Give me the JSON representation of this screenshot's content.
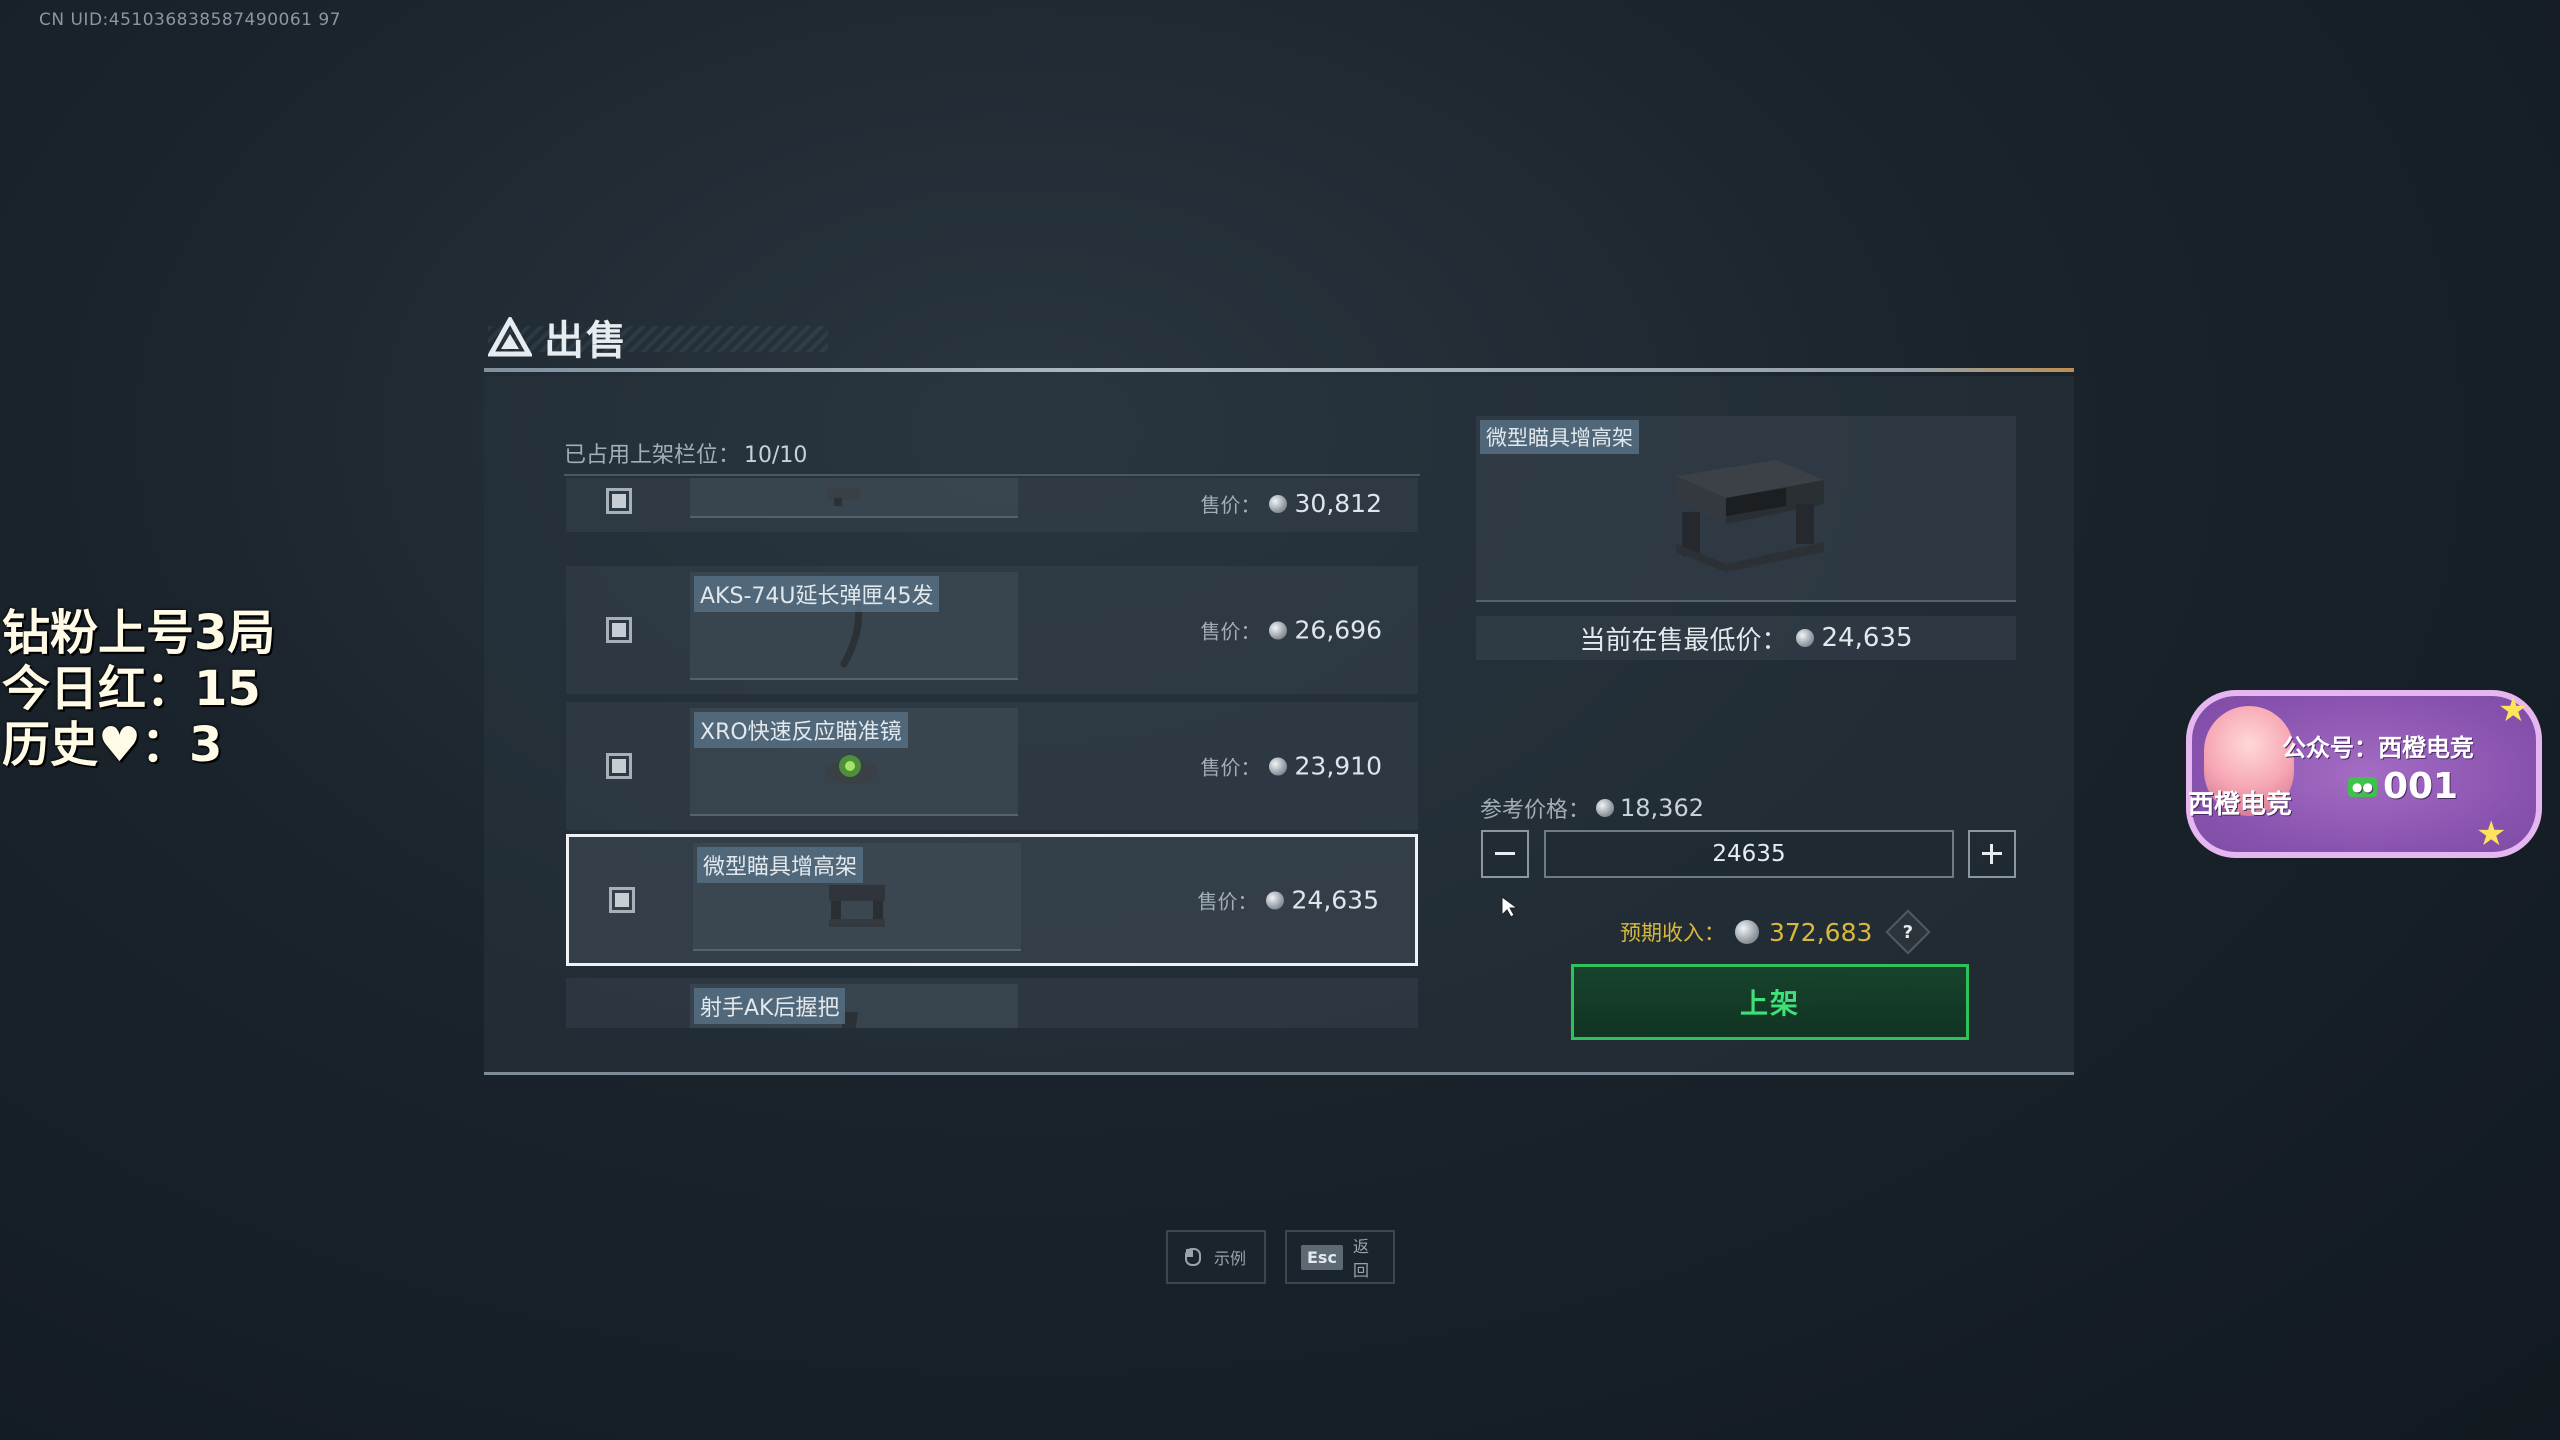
{
  "uid": "CN UID:451036838587490061 97",
  "overlay": {
    "line1": "钻粉上号3局",
    "line2": "今日红：15",
    "line3": "历史♥：3"
  },
  "header": {
    "title": "出售"
  },
  "slots": {
    "label": "已占用上架栏位：",
    "count": "10/10"
  },
  "list": {
    "price_label": "售价：",
    "items": [
      {
        "name": "",
        "price": "30,812"
      },
      {
        "name": "AKS-74U延长弹匣45发",
        "price": "26,696"
      },
      {
        "name": "XRO快速反应瞄准镜",
        "price": "23,910"
      },
      {
        "name": "微型瞄具增高架",
        "price": "24,635"
      },
      {
        "name": "射手AK后握把",
        "price": ""
      }
    ]
  },
  "detail": {
    "name": "微型瞄具增高架",
    "lowest_label": "当前在售最低价：",
    "lowest_price": "24,635",
    "ref_label": "参考价格：",
    "ref_price": "18,362",
    "input_value": "24635",
    "expected_label": "预期收入：",
    "expected_value": "372,683",
    "help": "?",
    "list_button": "上架"
  },
  "hints": {
    "example_label": "示例",
    "esc_key": "Esc",
    "back_label": "返回"
  },
  "badge": {
    "line1": "公众号：西橙电竞",
    "line2": "西橙电竞",
    "tag": "logo",
    "number": "001"
  },
  "colors": {
    "accent_green": "#2ec25a",
    "expected_gold": "#d8b93e",
    "badge_purple": "#8a54b0"
  }
}
